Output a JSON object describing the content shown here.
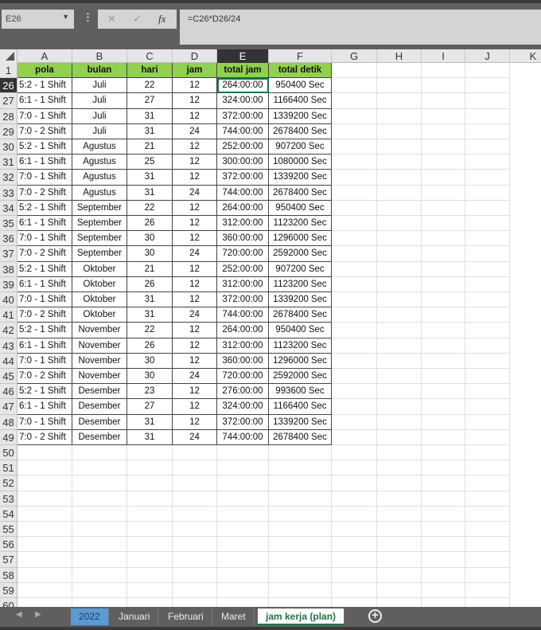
{
  "name_box": "E26",
  "formula": "=C26*D26/24",
  "formula_buttons": {
    "cancel": "✕",
    "enter": "✓",
    "fx": "fx"
  },
  "columns": [
    "A",
    "B",
    "C",
    "D",
    "E",
    "F",
    "G",
    "H",
    "I",
    "J",
    "K"
  ],
  "selected_column": "E",
  "header_row": {
    "row": "1",
    "cells": [
      "pola",
      "bulan",
      "hari",
      "jam",
      "total jam",
      "total detik"
    ]
  },
  "rows": [
    [
      "26",
      "5:2 - 1 Shift",
      "Juli",
      "22",
      "12",
      "264:00:00",
      "950400 Sec"
    ],
    [
      "27",
      "6:1 - 1 Shift",
      "Juli",
      "27",
      "12",
      "324:00:00",
      "1166400 Sec"
    ],
    [
      "28",
      "7:0 - 1 Shift",
      "Juli",
      "31",
      "12",
      "372:00:00",
      "1339200 Sec"
    ],
    [
      "29",
      "7:0 - 2 Shift",
      "Juli",
      "31",
      "24",
      "744:00:00",
      "2678400 Sec"
    ],
    [
      "30",
      "5:2 - 1 Shift",
      "Agustus",
      "21",
      "12",
      "252:00:00",
      "907200 Sec"
    ],
    [
      "31",
      "6:1 - 1 Shift",
      "Agustus",
      "25",
      "12",
      "300:00:00",
      "1080000 Sec"
    ],
    [
      "32",
      "7:0 - 1 Shift",
      "Agustus",
      "31",
      "12",
      "372:00:00",
      "1339200 Sec"
    ],
    [
      "33",
      "7:0 - 2 Shift",
      "Agustus",
      "31",
      "24",
      "744:00:00",
      "2678400 Sec"
    ],
    [
      "34",
      "5:2 - 1 Shift",
      "September",
      "22",
      "12",
      "264:00:00",
      "950400 Sec"
    ],
    [
      "35",
      "6:1 - 1 Shift",
      "September",
      "26",
      "12",
      "312:00:00",
      "1123200 Sec"
    ],
    [
      "36",
      "7:0 - 1 Shift",
      "September",
      "30",
      "12",
      "360:00:00",
      "1296000 Sec"
    ],
    [
      "37",
      "7:0 - 2 Shift",
      "September",
      "30",
      "24",
      "720:00:00",
      "2592000 Sec"
    ],
    [
      "38",
      "5:2 - 1 Shift",
      "Oktober",
      "21",
      "12",
      "252:00:00",
      "907200 Sec"
    ],
    [
      "39",
      "6:1 - 1 Shift",
      "Oktober",
      "26",
      "12",
      "312:00:00",
      "1123200 Sec"
    ],
    [
      "40",
      "7:0 - 1 Shift",
      "Oktober",
      "31",
      "12",
      "372:00:00",
      "1339200 Sec"
    ],
    [
      "41",
      "7:0 - 2 Shift",
      "Oktober",
      "31",
      "24",
      "744:00:00",
      "2678400 Sec"
    ],
    [
      "42",
      "5:2 - 1 Shift",
      "November",
      "22",
      "12",
      "264:00:00",
      "950400 Sec"
    ],
    [
      "43",
      "6:1 - 1 Shift",
      "November",
      "26",
      "12",
      "312:00:00",
      "1123200 Sec"
    ],
    [
      "44",
      "7:0 - 1 Shift",
      "November",
      "30",
      "12",
      "360:00:00",
      "1296000 Sec"
    ],
    [
      "45",
      "7:0 - 2 Shift",
      "November",
      "30",
      "24",
      "720:00:00",
      "2592000 Sec"
    ],
    [
      "46",
      "5:2 - 1 Shift",
      "Desember",
      "23",
      "12",
      "276:00:00",
      "993600 Sec"
    ],
    [
      "47",
      "6:1 - 1 Shift",
      "Desember",
      "27",
      "12",
      "324:00:00",
      "1166400 Sec"
    ],
    [
      "48",
      "7:0 - 1 Shift",
      "Desember",
      "31",
      "12",
      "372:00:00",
      "1339200 Sec"
    ],
    [
      "49",
      "7:0 - 2 Shift",
      "Desember",
      "31",
      "24",
      "744:00:00",
      "2678400 Sec"
    ]
  ],
  "empty_rows": [
    "50",
    "51",
    "52",
    "53",
    "54",
    "55",
    "56",
    "57",
    "58",
    "59",
    "60"
  ],
  "sheet_tabs": [
    "2022",
    "Januari",
    "Februari",
    "Maret",
    "jam kerja (plan)"
  ],
  "active_tab": "jam kerja (plan)"
}
